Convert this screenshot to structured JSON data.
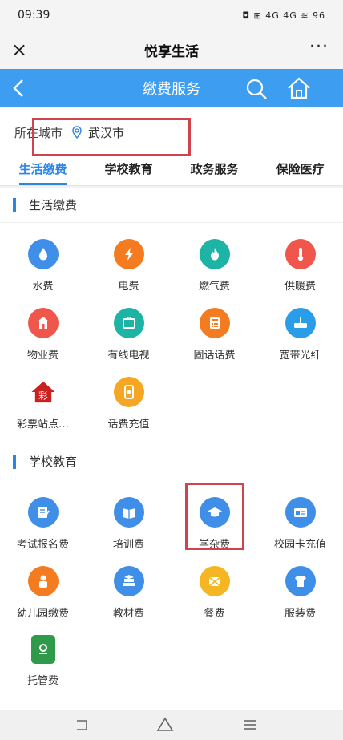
{
  "status": {
    "time": "09:39",
    "indicators": "◘ ⊞ 4G 4G ≋ 96"
  },
  "titlebar": {
    "close": "×",
    "title": "悦享生活",
    "more": "···"
  },
  "header": {
    "title": "缴费服务"
  },
  "city": {
    "label": "所在城市",
    "value": "武汉市"
  },
  "tabs": [
    "生活缴费",
    "学校教育",
    "政务服务",
    "保险医疗"
  ],
  "sections": [
    {
      "title": "生活缴费",
      "items": [
        {
          "label": "水费",
          "icon": "water-drop-icon",
          "color": "#3f8ee8"
        },
        {
          "label": "电费",
          "icon": "lightning-icon",
          "color": "#f47b20"
        },
        {
          "label": "燃气费",
          "icon": "flame-icon",
          "color": "#1db4a6"
        },
        {
          "label": "供暖费",
          "icon": "thermometer-icon",
          "color": "#f0564b"
        },
        {
          "label": "物业费",
          "icon": "building-icon",
          "color": "#f0564b"
        },
        {
          "label": "有线电视",
          "icon": "tv-icon",
          "color": "#1db4a6"
        },
        {
          "label": "固话话费",
          "icon": "landline-phone-icon",
          "color": "#f47b20"
        },
        {
          "label": "宽带光纤",
          "icon": "router-icon",
          "color": "#2a9de8"
        },
        {
          "label": "彩票站点…",
          "icon": "lottery-icon",
          "color": "#cc1f1f"
        },
        {
          "label": "话费充值",
          "icon": "mobile-phone-icon",
          "color": "#f5a623"
        }
      ]
    },
    {
      "title": "学校教育",
      "items": [
        {
          "label": "考试报名费",
          "icon": "exam-form-icon",
          "color": "#3f8ee8"
        },
        {
          "label": "培训费",
          "icon": "book-icon",
          "color": "#3f8ee8"
        },
        {
          "label": "学杂费",
          "icon": "graduation-cap-icon",
          "color": "#3f8ee8"
        },
        {
          "label": "校园卡充值",
          "icon": "campus-card-icon",
          "color": "#3f8ee8"
        },
        {
          "label": "幼儿园缴费",
          "icon": "kindergarten-icon",
          "color": "#f47b20"
        },
        {
          "label": "教材费",
          "icon": "textbooks-icon",
          "color": "#3f8ee8"
        },
        {
          "label": "餐费",
          "icon": "meal-icon",
          "color": "#f5b623"
        },
        {
          "label": "服装费",
          "icon": "uniform-icon",
          "color": "#3f8ee8"
        },
        {
          "label": "托管费",
          "icon": "childcare-icon",
          "color": "#2e9a4a"
        }
      ]
    }
  ]
}
